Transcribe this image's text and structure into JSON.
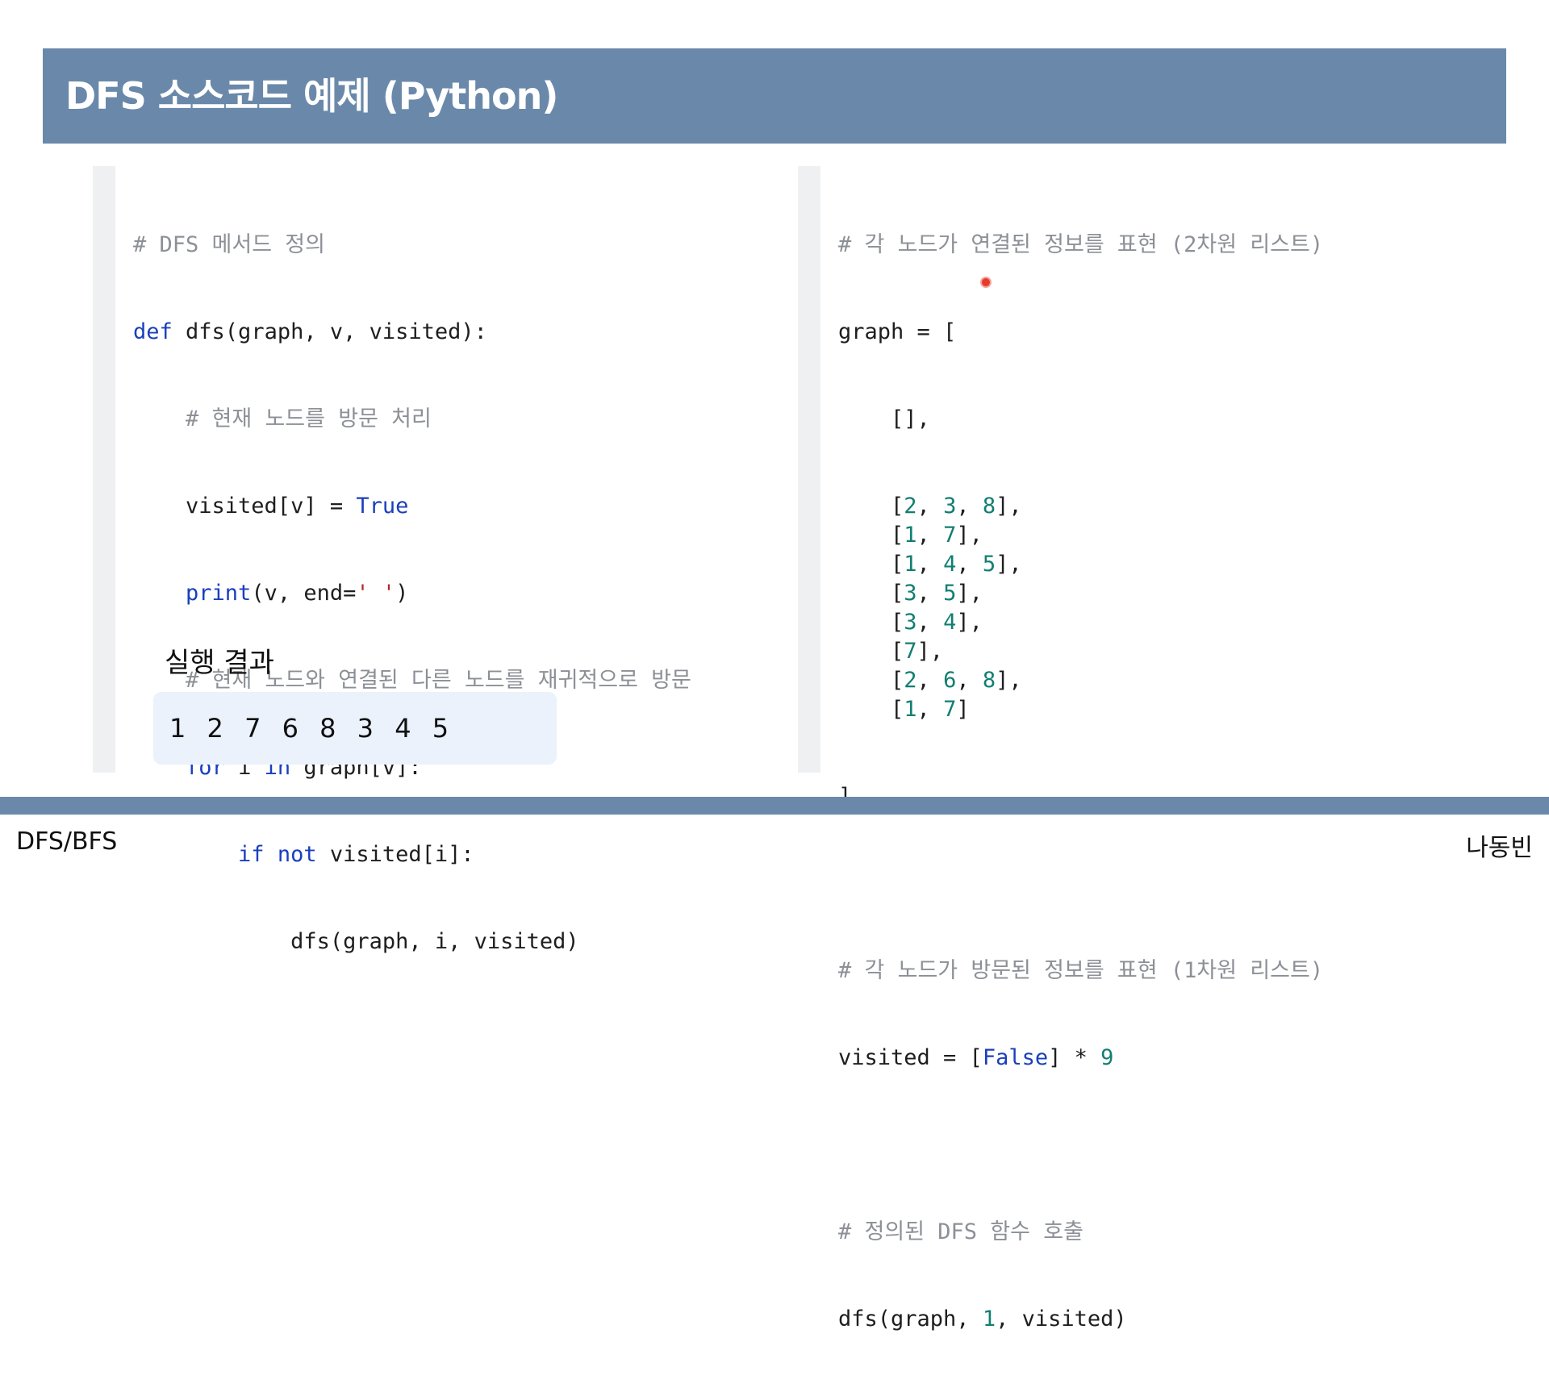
{
  "header": {
    "title": "DFS 소스코드 예제 (Python)"
  },
  "left_code": {
    "l1": "# DFS 메서드 정의",
    "l2_kw": "def",
    "l2_rest": " dfs(graph, v, visited):",
    "l3": "    # 현재 노드를 방문 처리",
    "l4_a": "    visited[v] = ",
    "l4_kw": "True",
    "l5_indent": "    ",
    "l5_fn": "print",
    "l5_a": "(v, end=",
    "l5_str": "' '",
    "l5_b": ")",
    "l6": "    # 현재 노드와 연결된 다른 노드를 재귀적으로 방문",
    "l7_indent": "    ",
    "l7_kw1": "for",
    "l7_mid": " i ",
    "l7_kw2": "in",
    "l7_rest": " graph[v]:",
    "l8_indent": "        ",
    "l8_kw1": "if",
    "l8_sp": " ",
    "l8_kw2": "not",
    "l8_rest": " visited[i]:",
    "l9": "            dfs(graph, i, visited)"
  },
  "right_code": {
    "r1": "# 각 노드가 연결된 정보를 표현 (2차원 리스트)",
    "r2": "graph = [",
    "r3": "    [],",
    "graph_rows": [
      [
        "2",
        "3",
        "8"
      ],
      [
        "1",
        "7"
      ],
      [
        "1",
        "4",
        "5"
      ],
      [
        "3",
        "5"
      ],
      [
        "3",
        "4"
      ],
      [
        "7"
      ],
      [
        "2",
        "6",
        "8"
      ],
      [
        "1",
        "7"
      ]
    ],
    "r_close": "]",
    "r_cmt2": "# 각 노드가 방문된 정보를 표현 (1차원 리스트)",
    "r_vis_a": "visited = [",
    "r_vis_kw": "False",
    "r_vis_b": "] * ",
    "r_vis_num": "9",
    "r_cmt3": "# 정의된 DFS 함수 호출",
    "r_call_a": "dfs(graph, ",
    "r_call_num": "1",
    "r_call_b": ", visited)"
  },
  "result": {
    "title": "실행 결과",
    "output": "1 2 7 6 8 3 4 5"
  },
  "footer": {
    "left": "DFS/BFS",
    "right": "나동빈"
  },
  "colors": {
    "header_bg": "#6a89aa",
    "keyword": "#1a3fbd",
    "number": "#127e72",
    "comment": "#8c9096",
    "string": "#b8252b",
    "result_bg": "#ebf2fb"
  }
}
